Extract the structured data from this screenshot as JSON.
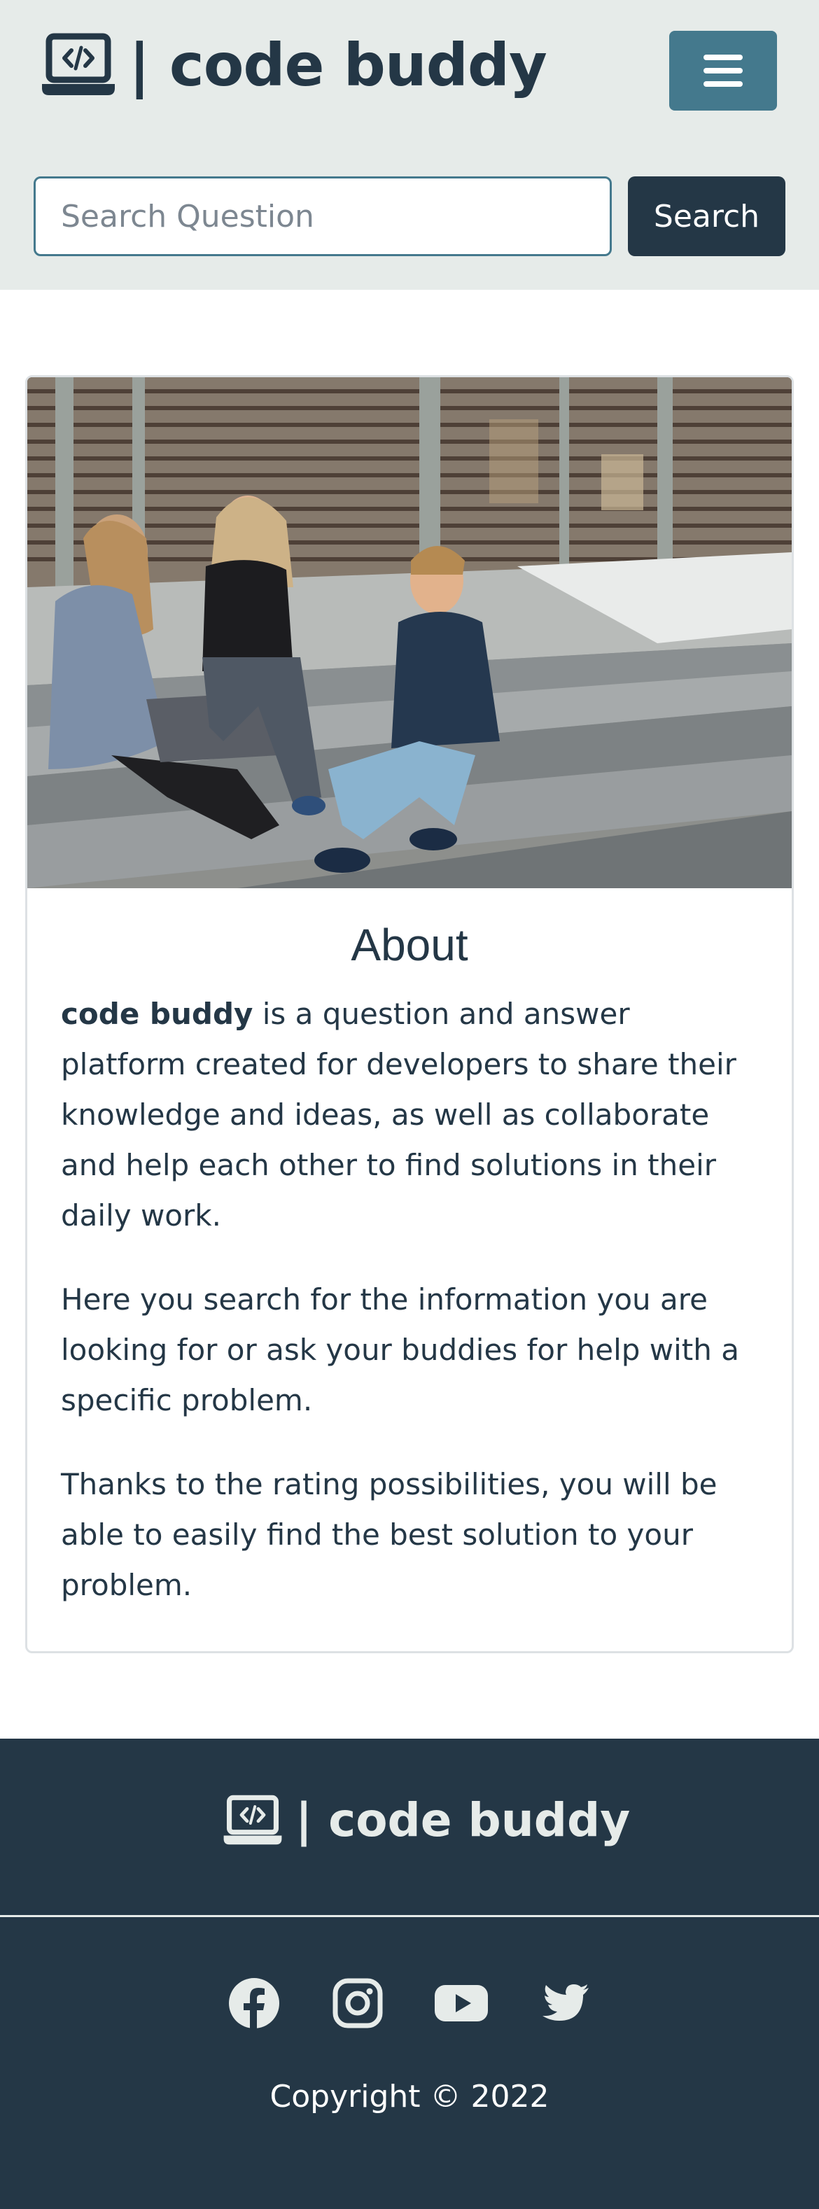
{
  "header": {
    "brand": "| code buddy",
    "brand_icon": "laptop-code-icon",
    "menu_icon": "hamburger-menu-icon",
    "search": {
      "placeholder": "Search Question",
      "value": "",
      "button_label": "Search"
    }
  },
  "about": {
    "image_alt": "Three people sitting on steps with a laptop",
    "title": "About",
    "paragraph1_bold": "code buddy",
    "paragraph1_rest": " is a question and answer platform created for developers to share their knowledge and ideas, as well as collaborate and help each other to find solutions in their daily work.",
    "paragraph2": "Here you search for the information you are looking for or ask your buddies for help with a specific problem.",
    "paragraph3": "Thanks to the rating possibilities, you will be able to easily find the best solution to your problem."
  },
  "footer": {
    "brand": "| code buddy",
    "social_icons": [
      "facebook-icon",
      "instagram-icon",
      "youtube-icon",
      "twitter-icon"
    ],
    "copyright": "Copyright © 2022"
  },
  "colors": {
    "header_bg": "#e6ebe9",
    "primary_dark": "#243746",
    "accent": "#44798d"
  }
}
